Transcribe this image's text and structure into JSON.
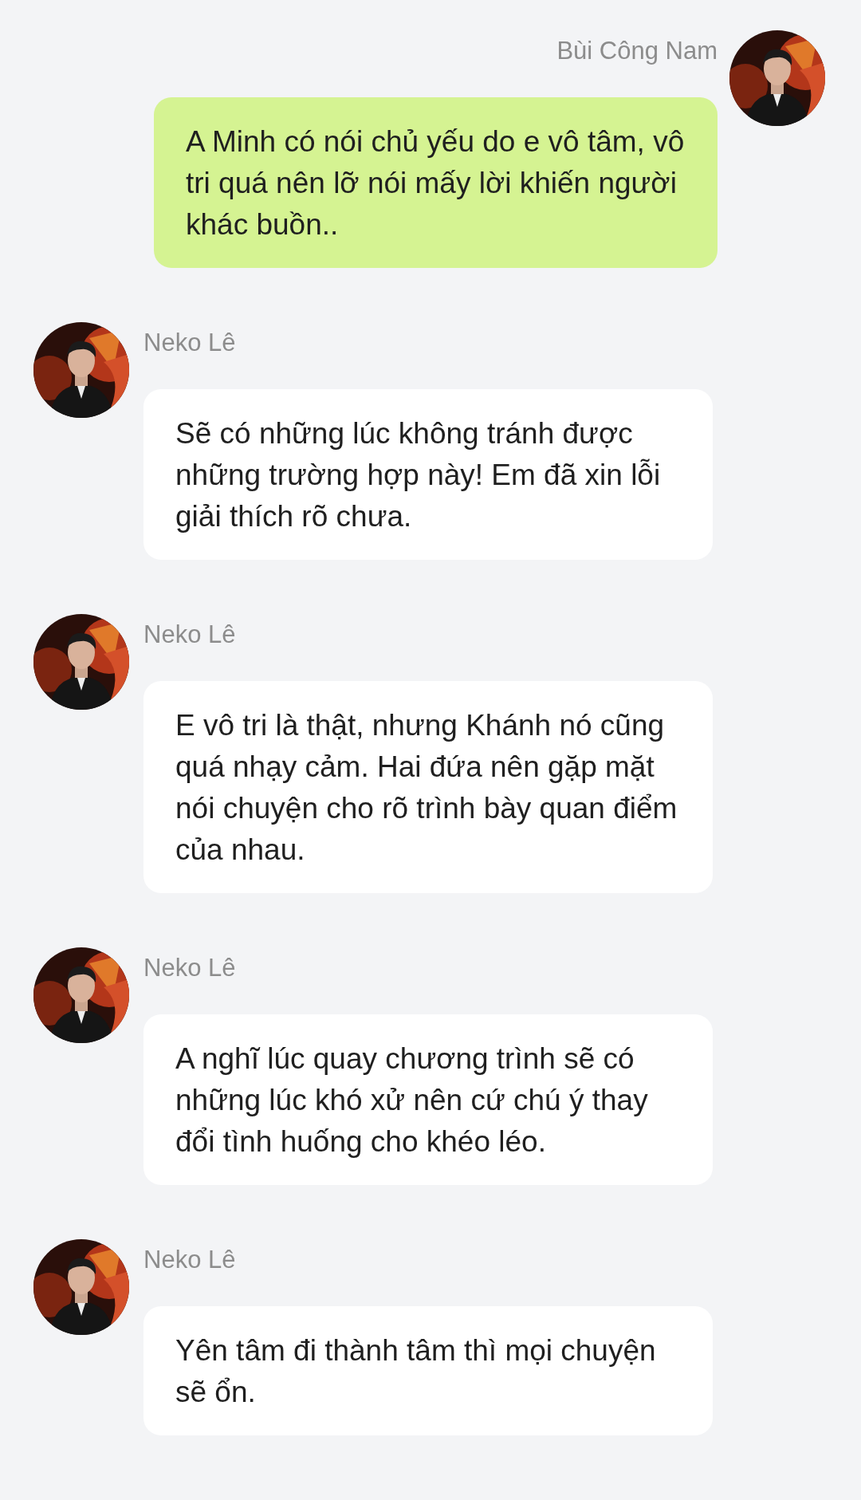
{
  "messages": [
    {
      "kind": "sent",
      "sender": "Bùi Công Nam",
      "text": "A Minh có nói chủ yếu do e vô tâm, vô tri quá nên lỡ nói mấy lời khiến người khác buồn.."
    },
    {
      "kind": "received",
      "sender": "Neko Lê",
      "text": "Sẽ có những lúc không tránh được những trường hợp này! Em đã xin lỗi giải thích rõ chưa."
    },
    {
      "kind": "received",
      "sender": "Neko Lê",
      "text": "E vô tri là thật, nhưng Khánh nó cũng quá nhạy cảm. Hai đứa nên gặp mặt nói chuyện cho rõ trình bày quan điểm của nhau."
    },
    {
      "kind": "received",
      "sender": "Neko Lê",
      "text": "A nghĩ lúc quay chương trình sẽ có những lúc khó xử nên cứ chú ý thay đổi tình huống cho khéo léo."
    },
    {
      "kind": "received",
      "sender": "Neko Lê",
      "text": "Yên tâm đi thành tâm thì mọi chuyện sẽ ổn."
    }
  ]
}
